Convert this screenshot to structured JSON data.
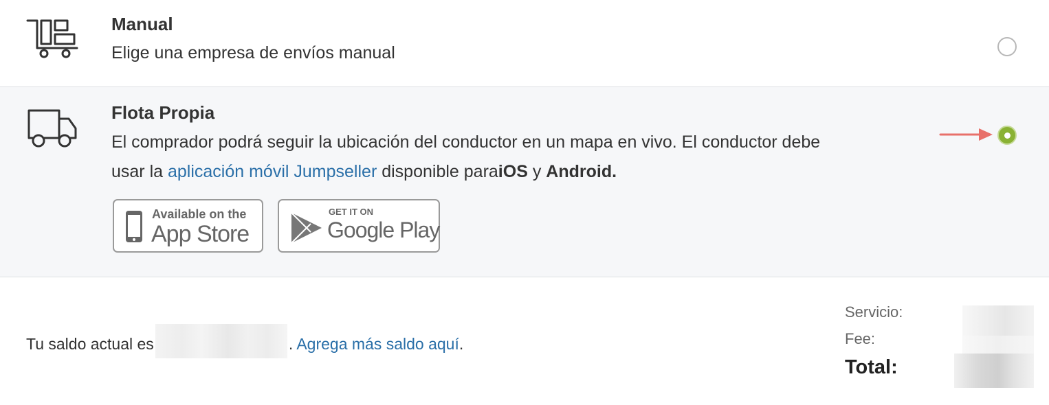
{
  "shipping_options": {
    "manual": {
      "icon": "cart-boxes-icon",
      "title": "Manual",
      "description": "Elige una empresa de envíos manual",
      "selected": false
    },
    "fleet": {
      "icon": "delivery-truck-icon",
      "title": "Flota Propia",
      "description_line1": "El comprador podrá seguir la ubicación del conductor en un mapa en vivo. El conductor debe",
      "description_prefix": "usar la ",
      "app_link": "aplicación móvil Jumpseller",
      "description_mid": " disponible para",
      "ios": "iOS",
      "conj": " y ",
      "android": "Android.",
      "selected": true,
      "arrow_color": "#e8706a"
    }
  },
  "store_badges": {
    "app_store": {
      "small": "Available on the",
      "big": "App Store",
      "icon": "phone-icon"
    },
    "google_play": {
      "small": "GET IT ON",
      "big": "Google Play",
      "icon": "play-triangle-icon"
    }
  },
  "balance": {
    "prefix": "Tu saldo actual es",
    "suffix": ". ",
    "link": "Agrega más saldo aquí",
    "end": "."
  },
  "summary": {
    "service_label": "Servicio:",
    "fee_label": "Fee:",
    "total_label": "Total:"
  },
  "colors": {
    "accent_green": "#8ab234",
    "link_blue": "#2a6fa8",
    "selected_bg": "#f6f7f9"
  }
}
